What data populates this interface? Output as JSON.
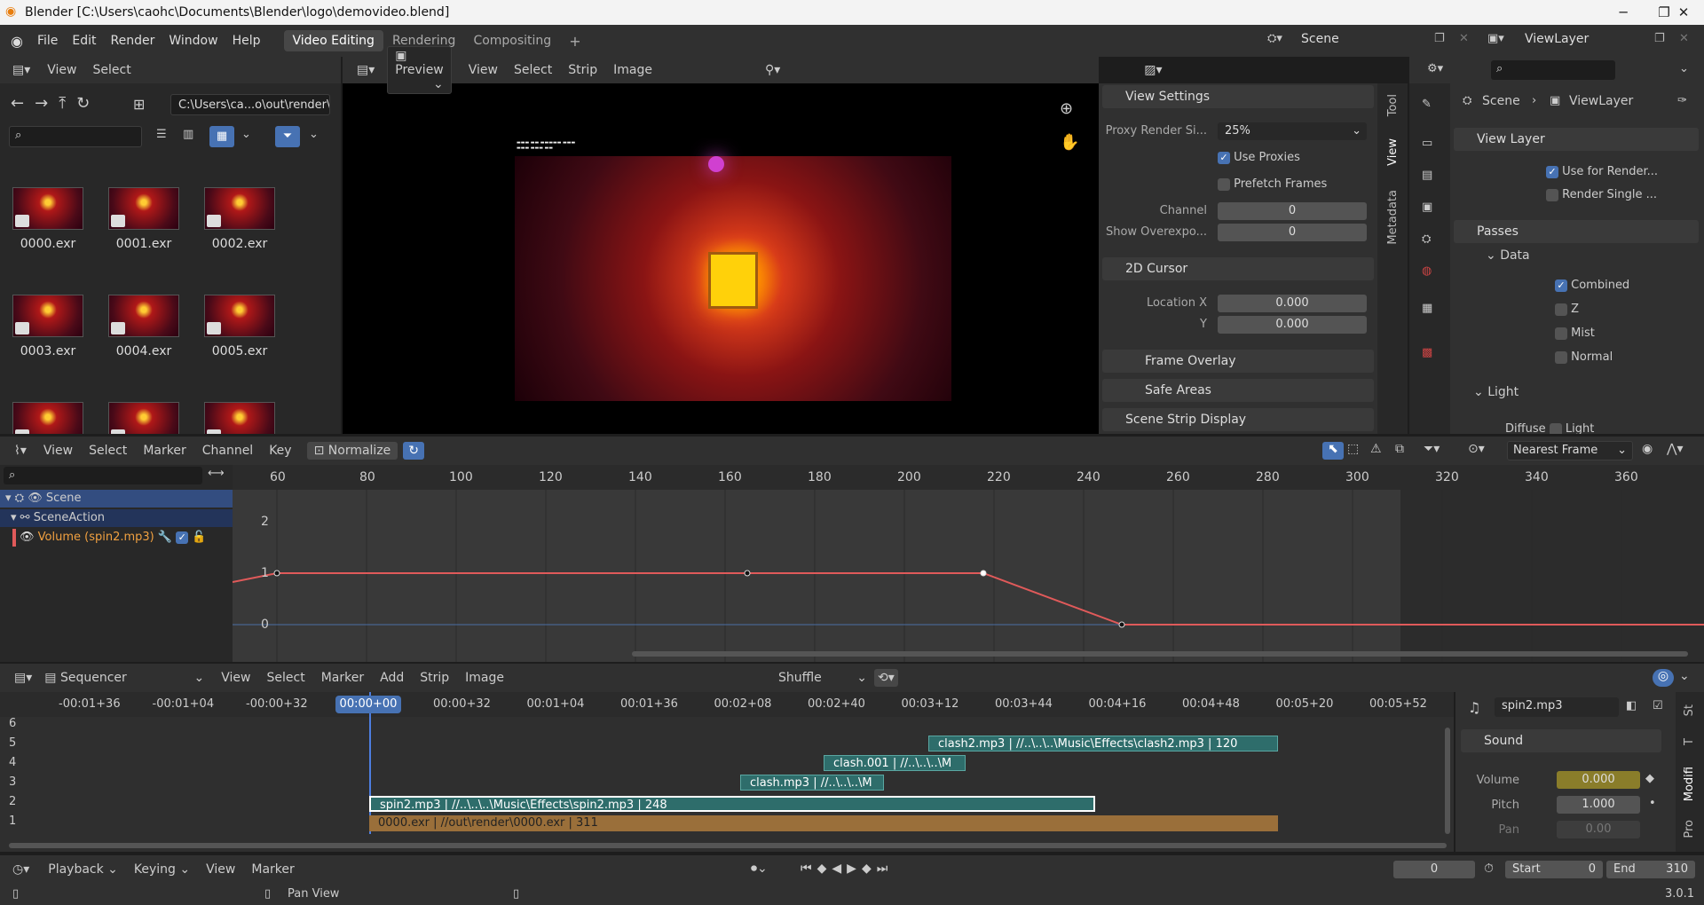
{
  "window": {
    "title": "Blender [C:\\Users\\caohc\\Documents\\Blender\\logo\\demovideo.blend]"
  },
  "menu": {
    "file": "File",
    "edit": "Edit",
    "render": "Render",
    "window": "Window",
    "help": "Help"
  },
  "workspaces": [
    "Video Editing",
    "Rendering",
    "Compositing"
  ],
  "scene": {
    "name": "Scene",
    "view_layer": "ViewLayer"
  },
  "filebrowser": {
    "view": "View",
    "select": "Select",
    "path": "C:\\Users\\ca...o\\out\\render\\",
    "files": [
      "0000.exr",
      "0001.exr",
      "0002.exr",
      "0003.exr",
      "0004.exr",
      "0005.exr"
    ]
  },
  "preview": {
    "mode": "Preview",
    "menus": [
      "View",
      "Select",
      "Strip",
      "Image"
    ]
  },
  "sidebar": {
    "tabs": [
      "Tool",
      "View",
      "Metadata"
    ],
    "view_settings": "View Settings",
    "proxy_label": "Proxy Render Si...",
    "proxy_value": "25%",
    "use_proxies": "Use Proxies",
    "prefetch": "Prefetch Frames",
    "channel_label": "Channel",
    "channel_value": "0",
    "overexpo_label": "Show Overexpo...",
    "overexpo_value": "0",
    "cursor": "2D Cursor",
    "loc_x_label": "Location X",
    "loc_x": "0.000",
    "y_label": "Y",
    "loc_y": "0.000",
    "frame_overlay": "Frame Overlay",
    "safe_areas": "Safe Areas",
    "scene_strip": "Scene Strip Display"
  },
  "props": {
    "scene": "Scene",
    "view_layer": "ViewLayer",
    "view_layer_panel": "View Layer",
    "use_render": "Use for Render...",
    "render_single": "Render Single ...",
    "passes": "Passes",
    "data": "Data",
    "combined": "Combined",
    "z": "Z",
    "mist": "Mist",
    "normal": "Normal",
    "light": "Light",
    "diffuse": "Diffuse",
    "light2": "Light"
  },
  "graph": {
    "menus": [
      "View",
      "Select",
      "Marker",
      "Channel",
      "Key"
    ],
    "normalize": "Normalize",
    "interp": "Nearest Frame",
    "ticks": [
      "60",
      "80",
      "100",
      "120",
      "140",
      "160",
      "180",
      "200",
      "220",
      "240",
      "260",
      "280",
      "300",
      "320",
      "340",
      "360"
    ],
    "yticks": [
      "2",
      "1",
      "0"
    ],
    "channels": {
      "scene": "Scene",
      "action": "SceneAction",
      "fcurve": "Volume (spin2.mp3)"
    },
    "curve_color": "#e05a5a"
  },
  "sequencer": {
    "mode": "Sequencer",
    "menus": [
      "View",
      "Select",
      "Marker",
      "Add",
      "Strip",
      "Image"
    ],
    "shuffle": "Shuffle",
    "ticks": [
      "-00:01+36",
      "-00:01+04",
      "-00:00+32",
      "00:00+00",
      "00:00+32",
      "00:01+04",
      "00:01+36",
      "00:02+08",
      "00:02+40",
      "00:03+12",
      "00:03+44",
      "00:04+16",
      "00:04+48",
      "00:05+20",
      "00:05+52"
    ],
    "channels": [
      "6",
      "5",
      "4",
      "3",
      "2",
      "1"
    ],
    "strips": {
      "clash2": "clash2.mp3 | //..\\..\\..\\Music\\Effects\\clash2.mp3 | 120",
      "clash001": "clash.001 | //..\\..\\..\\M",
      "clash": "clash.mp3 | //..\\..\\..\\M",
      "spin2": "spin2.mp3 | //..\\..\\..\\Music\\Effects\\spin2.mp3 | 248",
      "exr": "0000.exr | //out\\render\\0000.exr | 311"
    }
  },
  "strip_panel": {
    "name": "spin2.mp3",
    "sound": "Sound",
    "volume_label": "Volume",
    "volume": "0.000",
    "pitch_label": "Pitch",
    "pitch": "1.000",
    "pan_label": "Pan",
    "pan": "0.00",
    "tabs": [
      "St",
      "T",
      "Modifi",
      "Pro"
    ]
  },
  "timeline": {
    "playback": "Playback",
    "keying": "Keying",
    "view": "View",
    "marker": "Marker",
    "current": "0",
    "start_label": "Start",
    "start": "0",
    "end_label": "End",
    "end": "310"
  },
  "status": {
    "pan": "Pan View",
    "version": "3.0.1"
  }
}
